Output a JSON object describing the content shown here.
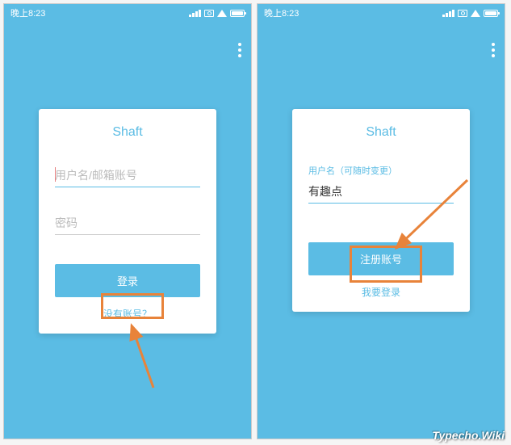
{
  "status": {
    "time": "晚上8:23"
  },
  "left": {
    "title": "Shaft",
    "username_placeholder": "用户名/邮箱账号",
    "password_placeholder": "密码",
    "login_btn": "登录",
    "no_account": "没有账号？"
  },
  "right": {
    "title": "Shaft",
    "username_label": "用户名（可随时变更）",
    "username_value": "有趣点",
    "register_btn": "注册账号",
    "want_login": "我要登录"
  },
  "watermark": "Typecho.Wiki"
}
